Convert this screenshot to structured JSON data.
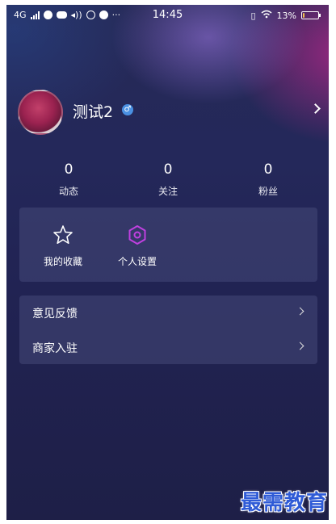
{
  "status_bar": {
    "network": "4G",
    "time": "14:45",
    "battery_percent": "13%",
    "battery_level": 0.13
  },
  "profile": {
    "username": "测试2",
    "gender_symbol": "♂"
  },
  "stats": [
    {
      "value": "0",
      "label": "动态"
    },
    {
      "value": "0",
      "label": "关注"
    },
    {
      "value": "0",
      "label": "粉丝"
    }
  ],
  "quick_actions": [
    {
      "label": "我的收藏",
      "icon": "star-icon"
    },
    {
      "label": "个人设置",
      "icon": "settings-hexagon-icon"
    }
  ],
  "menu": [
    {
      "label": "意见反馈"
    },
    {
      "label": "商家入驻"
    }
  ],
  "watermark": "最需教育",
  "colors": {
    "accent_purple": "#c040e0",
    "gender_badge": "#4a90e2",
    "watermark": "#2f5bd6"
  }
}
